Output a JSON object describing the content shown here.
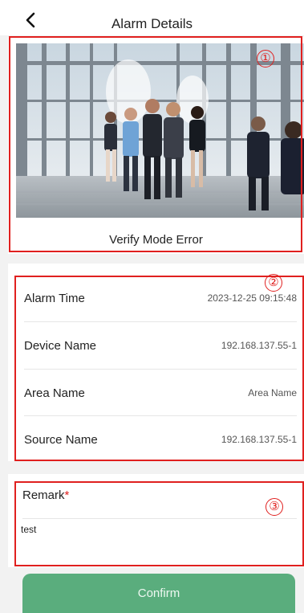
{
  "header": {
    "title": "Alarm Details",
    "back_icon": "chevron-left-icon"
  },
  "photo": {
    "caption": "Verify Mode Error"
  },
  "markers": [
    "①",
    "②",
    "③"
  ],
  "details": [
    {
      "label": "Alarm Time",
      "value": "2023-12-25 09:15:48"
    },
    {
      "label": "Device Name",
      "value": "192.168.137.55-1"
    },
    {
      "label": "Area Name",
      "value": "Area Name"
    },
    {
      "label": "Source Name",
      "value": "192.168.137.55-1"
    }
  ],
  "remark": {
    "label": "Remark",
    "required_mark": "*",
    "value": "test"
  },
  "confirm_label": "Confirm",
  "colors": {
    "highlight_red": "#e0201f",
    "confirm_green": "#5aad7d",
    "background": "#f2f2f2"
  }
}
